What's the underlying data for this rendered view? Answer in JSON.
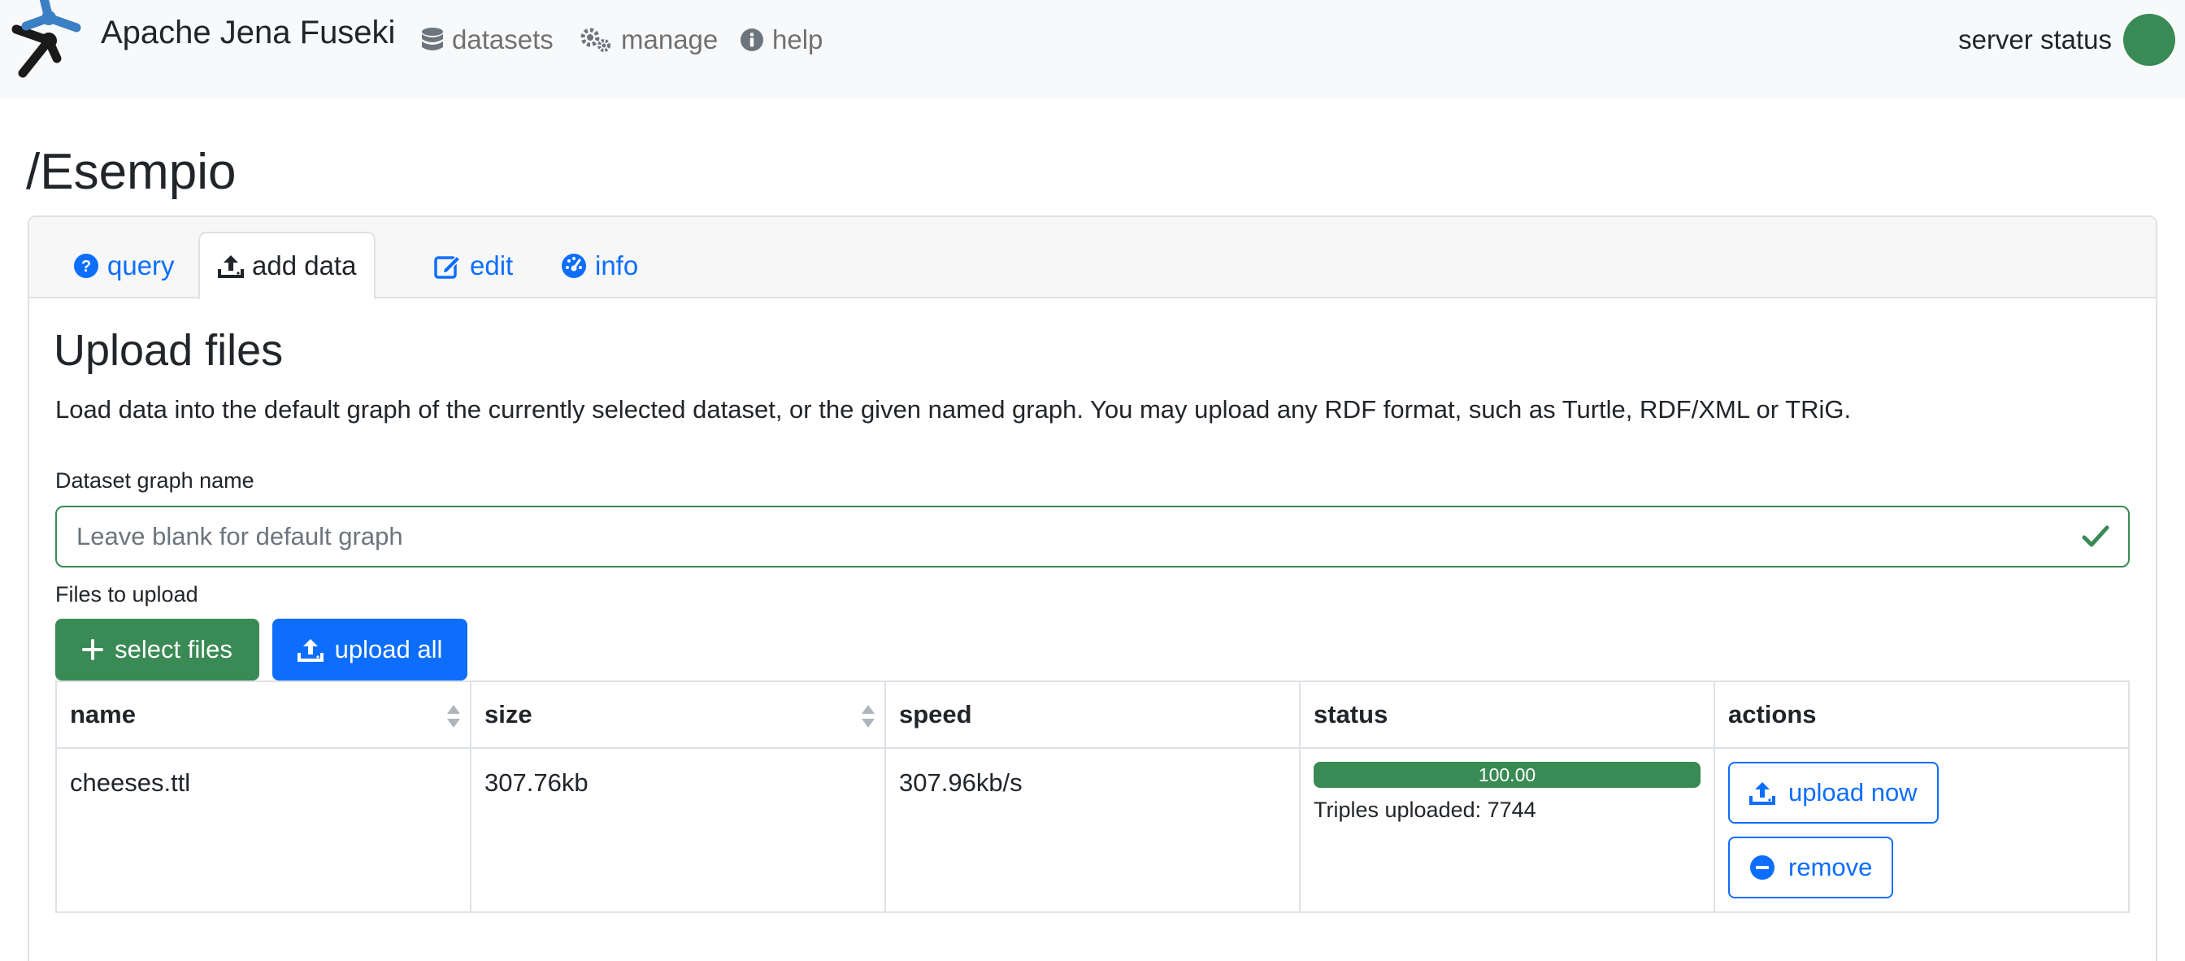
{
  "navbar": {
    "brand": "Apache Jena Fuseki",
    "links": [
      {
        "label": "datasets",
        "icon": "database-icon"
      },
      {
        "label": "manage",
        "icon": "gears-icon"
      },
      {
        "label": "help",
        "icon": "info-circle-icon"
      }
    ],
    "server_status_label": "server status",
    "server_status_color": "#3a8a55"
  },
  "page": {
    "title": "/Esempio"
  },
  "tabs": [
    {
      "label": "query",
      "icon": "question-circle-icon",
      "active": false
    },
    {
      "label": "add data",
      "icon": "upload-icon",
      "active": true
    },
    {
      "label": "edit",
      "icon": "edit-icon",
      "active": false
    },
    {
      "label": "info",
      "icon": "dashboard-icon",
      "active": false
    }
  ],
  "upload": {
    "title": "Upload files",
    "description": "Load data into the default graph of the currently selected dataset, or the given named graph. You may upload any RDF format, such as Turtle, RDF/XML or TRiG.",
    "graph_label": "Dataset graph name",
    "graph_placeholder": "Leave blank for default graph",
    "graph_value": "",
    "files_label": "Files to upload",
    "select_files_label": "select files",
    "upload_all_label": "upload all"
  },
  "table": {
    "columns": [
      "name",
      "size",
      "speed",
      "status",
      "actions"
    ],
    "rows": [
      {
        "name": "cheeses.ttl",
        "size": "307.76kb",
        "speed": "307.96kb/s",
        "progress_label": "100.00",
        "progress_percent": 100,
        "status_text": "Triples uploaded: 7744",
        "upload_now_label": "upload now",
        "remove_label": "remove"
      }
    ]
  },
  "colors": {
    "success": "#3a8a55",
    "primary": "#0d6efd",
    "navbar_bg": "#f8f9fa"
  }
}
